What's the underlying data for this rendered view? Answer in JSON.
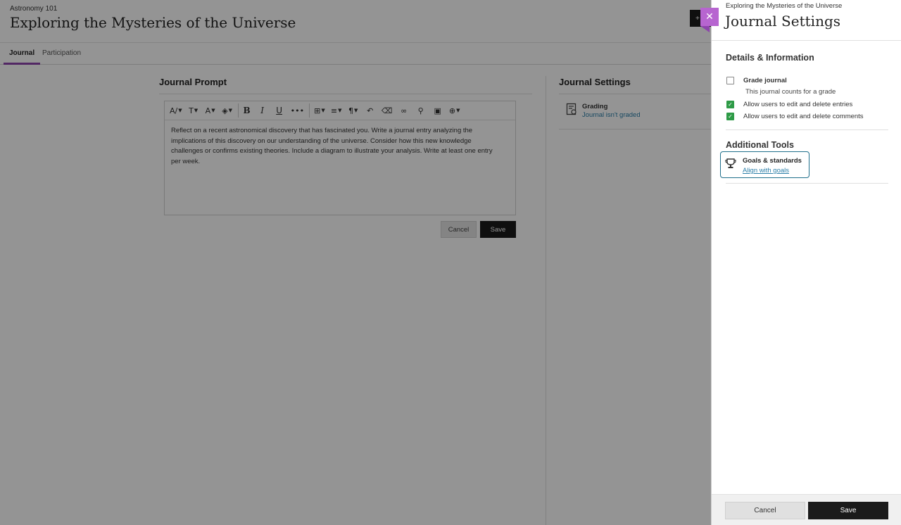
{
  "page": {
    "course": "Astronomy 101",
    "title": "Exploring the Mysteries of the Universe",
    "tabs": [
      {
        "label": "Journal",
        "active": true
      },
      {
        "label": "Participation",
        "active": false
      }
    ],
    "dark_tab_glyph": "+"
  },
  "prompt": {
    "heading": "Journal Prompt",
    "toolbar": [
      {
        "name": "paragraph-style-icon",
        "glyph": "A/",
        "dropdown": true
      },
      {
        "name": "text-format-icon",
        "glyph": "T",
        "dropdown": true
      },
      {
        "name": "font-size-icon",
        "glyph": "A",
        "dropdown": true
      },
      {
        "name": "text-color-icon",
        "glyph": "◈",
        "dropdown": true
      },
      {
        "name": "bold-icon",
        "glyph": "B",
        "dropdown": false
      },
      {
        "name": "italic-icon",
        "glyph": "I",
        "dropdown": false
      },
      {
        "name": "underline-icon",
        "glyph": "U",
        "dropdown": false
      },
      {
        "name": "more-icon",
        "glyph": "•••",
        "dropdown": false
      },
      {
        "name": "table-icon",
        "glyph": "⊞",
        "dropdown": true
      },
      {
        "name": "align-icon",
        "glyph": "≡",
        "dropdown": true
      },
      {
        "name": "paragraph-icon",
        "glyph": "¶",
        "dropdown": true
      },
      {
        "name": "undo-icon",
        "glyph": "↶",
        "dropdown": false
      },
      {
        "name": "clear-format-icon",
        "glyph": "⌫",
        "dropdown": false
      },
      {
        "name": "link-icon",
        "glyph": "∞",
        "dropdown": false
      },
      {
        "name": "attach-icon",
        "glyph": "⚲",
        "dropdown": false
      },
      {
        "name": "image-icon",
        "glyph": "▣",
        "dropdown": false
      },
      {
        "name": "insert-icon",
        "glyph": "⊕",
        "dropdown": true
      }
    ],
    "text": "Reflect on a recent astronomical discovery that has fascinated you. Write a journal entry analyzing the implications of this discovery on our understanding of the universe. Consider how this new knowledge challenges or confirms existing theories. Include a diagram to illustrate your analysis. Write at least one entry per week.",
    "cancel_label": "Cancel",
    "save_label": "Save"
  },
  "settings_column": {
    "heading": "Journal Settings",
    "grading_title": "Grading",
    "grading_status": "Journal isn't graded"
  },
  "panel": {
    "close_glyph": "✕",
    "subtitle": "Exploring the Mysteries of the Universe",
    "title": "Journal Settings",
    "details_heading": "Details & Information",
    "options": [
      {
        "label": "Grade journal",
        "checked": false,
        "help": "This journal counts for a grade"
      },
      {
        "label": "Allow users to edit and delete entries",
        "checked": true
      },
      {
        "label": "Allow users to edit and delete comments",
        "checked": true
      }
    ],
    "tools_heading": "Additional Tools",
    "goals_title": "Goals & standards",
    "goals_link": "Align with goals",
    "cancel_label": "Cancel",
    "save_label": "Save"
  },
  "colors": {
    "accent_purple": "#b765d0",
    "checkbox_green": "#2e9b47",
    "link_blue": "#2a7ea8",
    "focus_outline": "#1f6f8b",
    "primary_button": "#1a1a1a"
  }
}
